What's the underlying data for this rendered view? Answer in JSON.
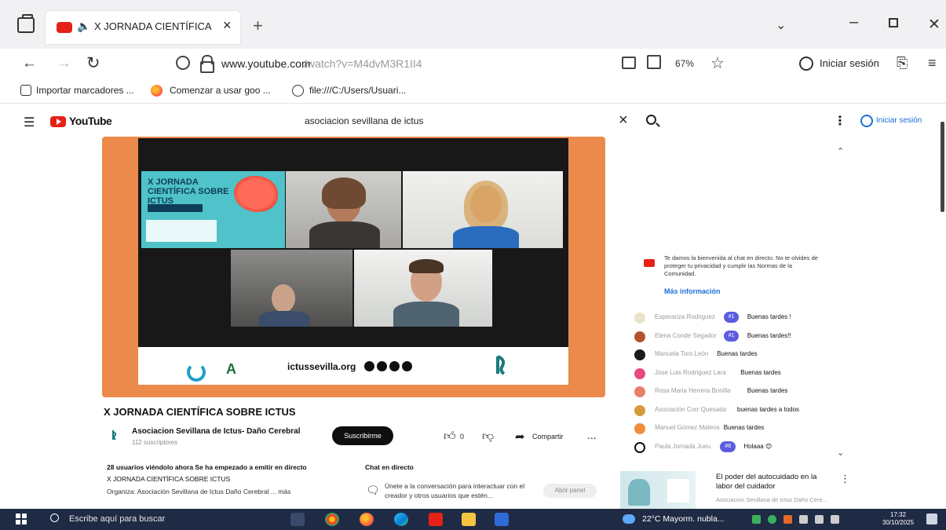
{
  "browser": {
    "tab_title": "X JORNADA CIENTÍFICA SC",
    "url_host": "www.youtube.com",
    "url_path": "/watch?v=M4dvM3R1II4",
    "zoom": "67%",
    "signin": "Iniciar sesión",
    "bookmarks": [
      "Importar marcadores ...",
      "Comenzar a usar goo ...",
      "file:///C:/Users/Usuari..."
    ]
  },
  "youtube": {
    "wordmark": "YouTube",
    "search_query": "asociacion sevillana de ictus",
    "signin": "Iniciar sesión"
  },
  "video": {
    "overlay_text": "",
    "slide_title": "X JORNADA CIENTÍFICA SOBRE ICTUS",
    "sponsor_url": "ictussevilla.org",
    "title": "X JORNADA CIENTÍFICA SOBRE ICTUS",
    "channel_name": "Asociacion Sevillana de Ictus- Daño Cerebral",
    "channel_subs": "112 suscriptores",
    "subscribe_label": "Suscribirme",
    "like_count": "0",
    "share_label": "Compartir",
    "more_label": "...",
    "desc_live": "28 usuarios viéndolo ahora  Se ha empezado a emitir en directo",
    "desc_title": "X JORNADA CIENTÍFICA SOBRE ICTUS",
    "desc_org": "Organiza: Asociación Sevillana de Ictus Daño Cerebral ... más"
  },
  "chat": {
    "label": "Chat en directo",
    "join_text": "Únete a la conversación para interactuar con el creador y otros usuarios que estén...",
    "open_label": "Abrir panel",
    "welcome_text": "Te damos la bienvenida al chat en directo. No te olvides de proteger tu privacidad y cumplir las Normas de la Comunidad.",
    "welcome_more": "Más información",
    "messages": [
      {
        "author": "Esperanza Rodriguez",
        "badge": "#1",
        "text": "Buenas tardes !",
        "color": "#e8e4cc"
      },
      {
        "author": "Elena Conde Segador",
        "badge": "#1",
        "text": "Buenas tardes!!",
        "color": "#b5522e"
      },
      {
        "author": "Manuela Toro León",
        "badge": "",
        "text": "Buenas tardes",
        "color": "#1a1a1a"
      },
      {
        "author": "Jose Luis Rodriguez Lara",
        "badge": "",
        "text": "Buenas tardes",
        "color": "#e84a7c"
      },
      {
        "author": "Rosa Maria Herrera Bonilla",
        "badge": "",
        "text": "Buenas tardes",
        "color": "#e8806a"
      },
      {
        "author": "Asociación Corr Quesada",
        "badge": "",
        "text": "buenas tardes a todos",
        "color": "#d59a3a"
      },
      {
        "author": "Manuel Gómez Mateos",
        "badge": "",
        "text": "Buenas tardes",
        "color": "#f08c3a"
      },
      {
        "author": "Paula Jornada Jueu",
        "badge": "#8",
        "text": "Holaaa 😊",
        "color": "#ffffff"
      }
    ]
  },
  "recommendation": {
    "title": "El poder del autocuidado en la labor del cuidador",
    "channel": "Asociacion Sevillana de Ictus  Daño Cere..."
  },
  "taskbar": {
    "search_placeholder": "Escribe aquí para buscar",
    "weather": "22°C  Mayorm. nubla...",
    "time": "17:32",
    "date": "30/10/2025"
  }
}
